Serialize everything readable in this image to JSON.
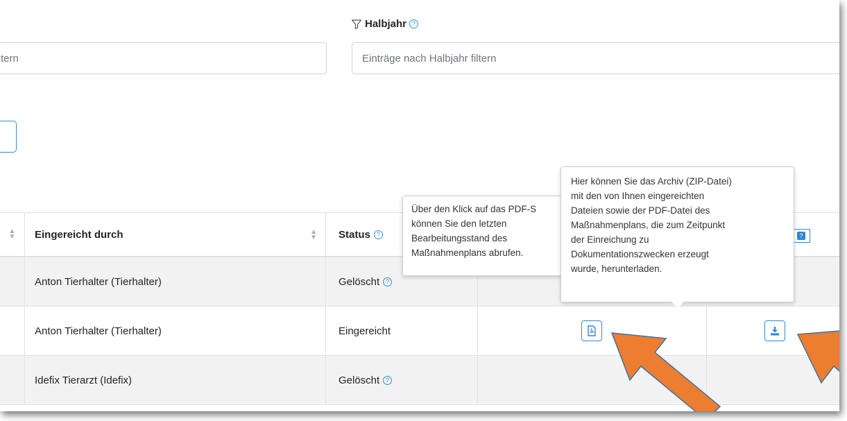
{
  "filters": {
    "left_input_value": "tern",
    "halbjahr_label": "Halbjahr",
    "halbjahr_placeholder": "Einträge nach Halbjahr filtern"
  },
  "table": {
    "headers": {
      "submitted_by": "Eingereicht durch",
      "status": "Status"
    },
    "rows": [
      {
        "submitted_by": "Anton Tierhalter (Tierhalter)",
        "status": "Gelöscht",
        "status_help": true,
        "shaded": true
      },
      {
        "submitted_by": "Anton Tierhalter (Tierhalter)",
        "status": "Eingereicht",
        "status_help": false,
        "shaded": false
      },
      {
        "submitted_by": "Idefix Tierarzt (Idefix)",
        "status": "Gelöscht",
        "status_help": true,
        "shaded": true
      }
    ]
  },
  "tooltips": {
    "pdf": "Über den Klick auf das PDF-S\nkönnen Sie den letzten\nBearbeitungsstand des\nMaßnahmenplans abrufen.",
    "zip": "Hier können Sie das Archiv (ZIP-Datei)\nmit den von Ihnen eingereichten\nDateien sowie der PDF-Datei des\nMaßnahmenplans, die zum Zeitpunkt\nder Einreichung zu\nDokumentationszwecken erzeugt\nwurde, herunterladen."
  },
  "icons": {
    "filter": "filter-funnel-icon",
    "help": "question-circle-icon",
    "pdf": "pdf-file-icon",
    "download": "download-icon",
    "sort": "sort-icon"
  },
  "colors": {
    "accent": "#2e86d9",
    "arrow_fill": "#ed7d31",
    "arrow_stroke": "#41719c",
    "row_shade": "#f2f2f2"
  }
}
